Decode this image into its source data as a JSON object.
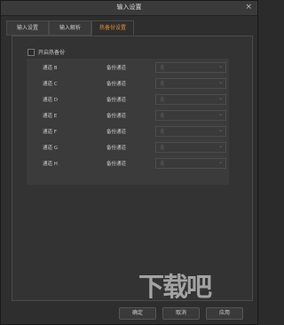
{
  "window": {
    "title": "输入设置",
    "close_glyph": "×"
  },
  "tabs": [
    {
      "label": "输入设置"
    },
    {
      "label": "输入解析"
    },
    {
      "label": "热备份设置"
    }
  ],
  "hot_backup": {
    "enable_label": "开启热备份",
    "checked": false
  },
  "rows": [
    {
      "channel": "通道 B",
      "backup_label": "备份通道",
      "value": "无"
    },
    {
      "channel": "通道 C",
      "backup_label": "备份通道",
      "value": "无"
    },
    {
      "channel": "通道 D",
      "backup_label": "备份通道",
      "value": "无"
    },
    {
      "channel": "通道 E",
      "backup_label": "备份通道",
      "value": "无"
    },
    {
      "channel": "通道 F",
      "backup_label": "备份通道",
      "value": "无"
    },
    {
      "channel": "通道 G",
      "backup_label": "备份通道",
      "value": "无"
    },
    {
      "channel": "通道 H",
      "backup_label": "备份通道",
      "value": "无"
    }
  ],
  "footer": {
    "ok_label": "确定",
    "cancel_label": "取消",
    "apply_label": "应用"
  },
  "watermark": "下载吧",
  "colors": {
    "accent": "#e58a3a",
    "background": "#2e2e2e"
  }
}
